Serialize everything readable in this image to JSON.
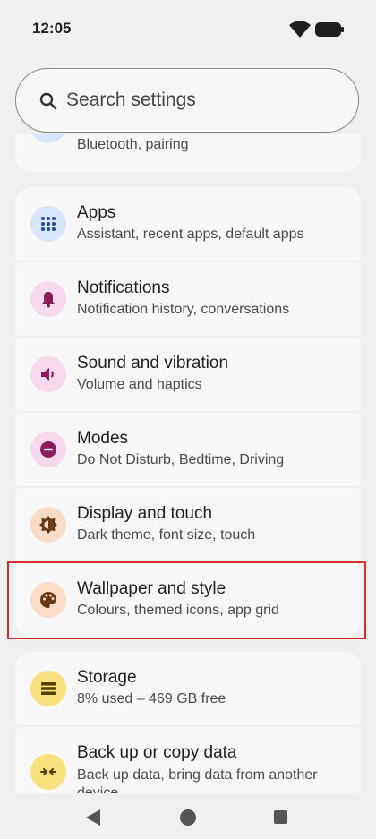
{
  "status_bar": {
    "time": "12:05"
  },
  "search": {
    "placeholder": "Search settings"
  },
  "items": [
    {
      "title": "",
      "subtitle": "Bluetooth, pairing",
      "icon": "devices-icon",
      "icon_bg": "#d9e5fb",
      "icon_color": "#1d4d9a"
    },
    {
      "title": "Apps",
      "subtitle": "Assistant, recent apps, default apps",
      "icon": "apps-grid-icon",
      "icon_bg": "#d9e5fb",
      "icon_color": "#1d4d9a"
    },
    {
      "title": "Notifications",
      "subtitle": "Notification history, conversations",
      "icon": "bell-icon",
      "icon_bg": "#f6d9ec",
      "icon_color": "#8a1c5c"
    },
    {
      "title": "Sound and vibration",
      "subtitle": "Volume and haptics",
      "icon": "speaker-icon",
      "icon_bg": "#f6d9ec",
      "icon_color": "#8a1c5c"
    },
    {
      "title": "Modes",
      "subtitle": "Do Not Disturb, Bedtime, Driving",
      "icon": "do-not-disturb-icon",
      "icon_bg": "#f6d9ec",
      "icon_color": "#8a1c5c"
    },
    {
      "title": "Display and touch",
      "subtitle": "Dark theme, font size, touch",
      "icon": "brightness-icon",
      "icon_bg": "#f8dcc7",
      "icon_color": "#6a3a16"
    },
    {
      "title": "Wallpaper and style",
      "subtitle": "Colours, themed icons, app grid",
      "icon": "palette-icon",
      "icon_bg": "#f8dcc7",
      "icon_color": "#6a3a16"
    },
    {
      "title": "Storage",
      "subtitle": "8% used – 469 GB free",
      "icon": "storage-icon",
      "icon_bg": "#f7e17e",
      "icon_color": "#4f4100"
    },
    {
      "title": "Back up or copy data",
      "subtitle": "Back up data, bring data from another device",
      "icon": "backup-transfer-icon",
      "icon_bg": "#f7e17e",
      "icon_color": "#4f4100"
    }
  ],
  "highlight_color": "#d32f2f"
}
